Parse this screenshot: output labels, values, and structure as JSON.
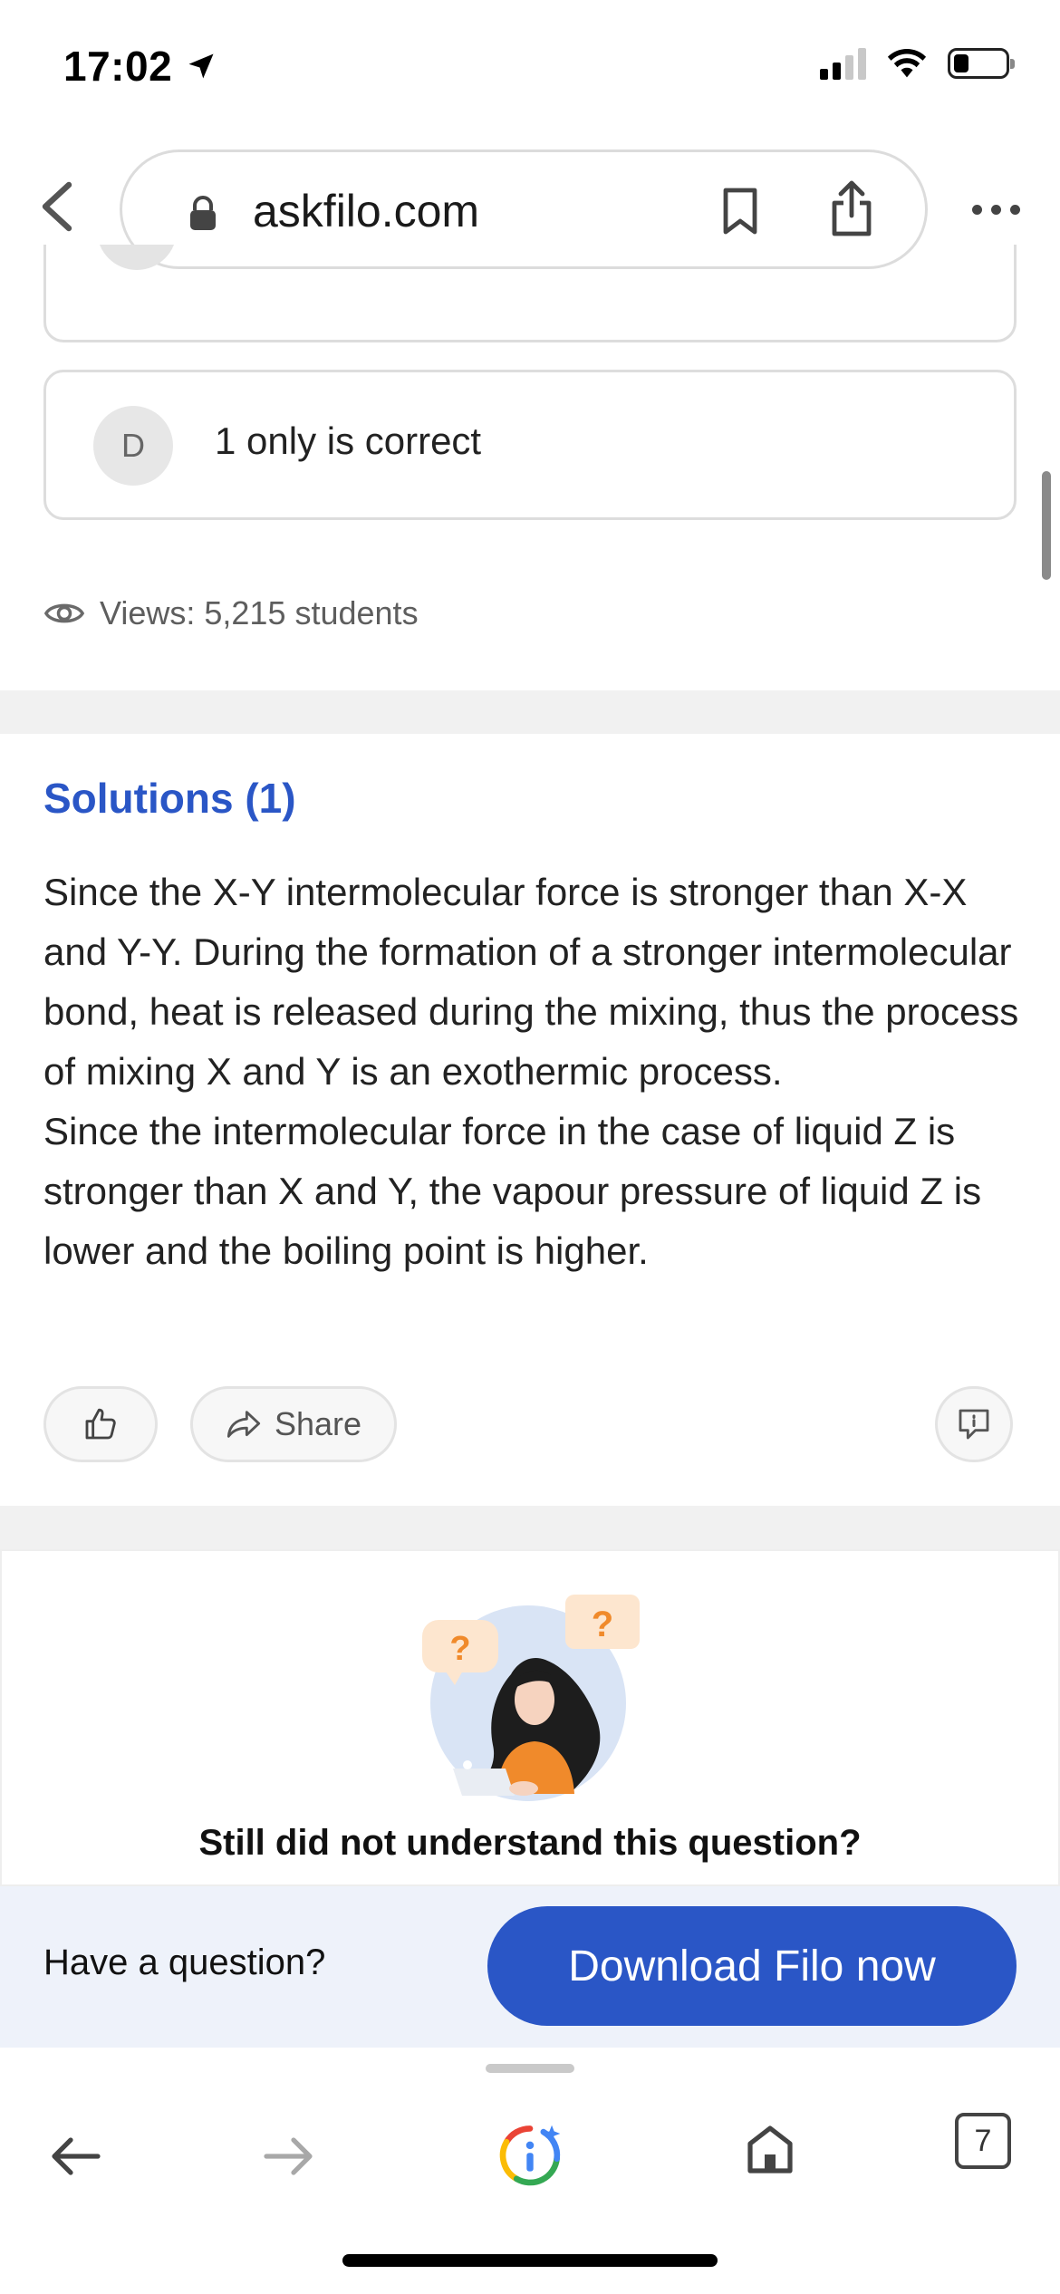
{
  "status_bar": {
    "time": "17:02"
  },
  "browser": {
    "url": "askfilo.com",
    "tab_count": "7"
  },
  "question": {
    "option_d": {
      "letter": "D",
      "text": "1 only is correct"
    },
    "views": "Views: 5,215 students"
  },
  "solutions": {
    "title": "Solutions (1)",
    "paragraph_1": "Since the X-Y intermolecular force is stronger than X-X and Y-Y. During the formation of a stronger intermolecular bond, heat is released during the mixing, thus the process of mixing X and Y is an exothermic process.",
    "paragraph_2": "Since the intermolecular force in the case of liquid Z is stronger than X and Y, the vapour pressure of liquid Z is lower and the boiling point is higher.",
    "share_label": "Share"
  },
  "help": {
    "still_text": "Still did not understand this question?",
    "bubble_left": "?",
    "bubble_right": "?"
  },
  "cta": {
    "question_label": "Have a question?",
    "download_label": "Download Filo now"
  },
  "colors": {
    "accent": "#2a56c6",
    "illustration_orange": "#f08a2b"
  }
}
